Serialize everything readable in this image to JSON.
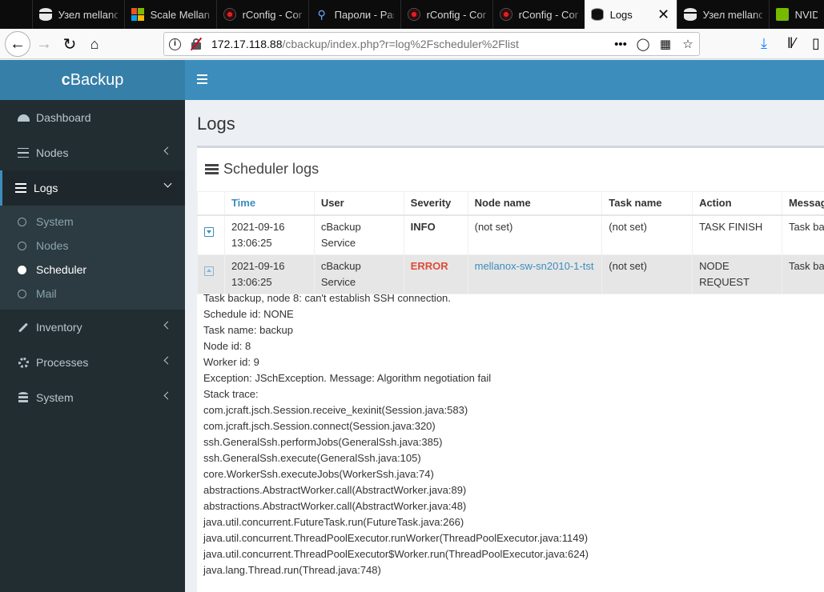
{
  "browser": {
    "tabs": [
      {
        "label": "Узел mellanox",
        "icon": "database-icon"
      },
      {
        "label": "Scale Mellanox",
        "icon": "grid-icon"
      },
      {
        "label": "rConfig - Con",
        "icon": "rconfig-icon"
      },
      {
        "label": "Пароли - Pas",
        "icon": "key-icon"
      },
      {
        "label": "rConfig - Con",
        "icon": "rconfig-icon"
      },
      {
        "label": "rConfig - Con",
        "icon": "rconfig-icon"
      },
      {
        "label": "Logs",
        "icon": "database-icon",
        "active": true
      },
      {
        "label": "Узел mellanox",
        "icon": "database-icon"
      },
      {
        "label": "NVIDIA",
        "icon": "nvidia-icon"
      }
    ],
    "url_host": "172.17.118.88",
    "url_path": "/cbackup/index.php?r=log%2Fscheduler%2Flist"
  },
  "app": {
    "brand_bold": "c",
    "brand_rest": "Backup",
    "accent": "#3c8dbc",
    "sidebar_bg": "#222d32"
  },
  "sidebar": {
    "dashboard": "Dashboard",
    "nodes": "Nodes",
    "logs": "Logs",
    "logs_sub": [
      "System",
      "Nodes",
      "Scheduler",
      "Mail"
    ],
    "inventory": "Inventory",
    "processes": "Processes",
    "system": "System"
  },
  "page": {
    "title": "Logs",
    "box_title": "Scheduler logs"
  },
  "table": {
    "headers": [
      "Time",
      "User",
      "Severity",
      "Node name",
      "Task name",
      "Action",
      "Messag"
    ],
    "rows": [
      {
        "time_date": "2021-09-16",
        "time_clock": "13:06:25",
        "user_1": "cBackup",
        "user_2": "Service",
        "severity": "INFO",
        "node": "(not set)",
        "task": "(not set)",
        "action": "TASK FINISH",
        "message": "Task ba"
      },
      {
        "time_date": "2021-09-16",
        "time_clock": "13:06:25",
        "user_1": "cBackup",
        "user_2": "Service",
        "severity": "ERROR",
        "node": "mellanox-sw-sn2010-1-tst",
        "task": "(not set)",
        "action": "NODE REQUEST",
        "message": "Task ba"
      }
    ]
  },
  "details": [
    "Task backup, node 8: can't establish SSH connection.",
    "Schedule id: NONE",
    "Task name: backup",
    "Node id: 8",
    "Worker id: 9",
    "Exception: JSchException. Message: Algorithm negotiation fail",
    "Stack trace:",
    "com.jcraft.jsch.Session.receive_kexinit(Session.java:583)",
    "com.jcraft.jsch.Session.connect(Session.java:320)",
    "ssh.GeneralSsh.performJobs(GeneralSsh.java:385)",
    "ssh.GeneralSsh.execute(GeneralSsh.java:105)",
    "core.WorkerSsh.executeJobs(WorkerSsh.java:74)",
    "abstractions.AbstractWorker.call(AbstractWorker.java:89)",
    "abstractions.AbstractWorker.call(AbstractWorker.java:48)",
    "java.util.concurrent.FutureTask.run(FutureTask.java:266)",
    "java.util.concurrent.ThreadPoolExecutor.runWorker(ThreadPoolExecutor.java:1149)",
    "java.util.concurrent.ThreadPoolExecutor$Worker.run(ThreadPoolExecutor.java:624)",
    "java.lang.Thread.run(Thread.java:748)"
  ]
}
